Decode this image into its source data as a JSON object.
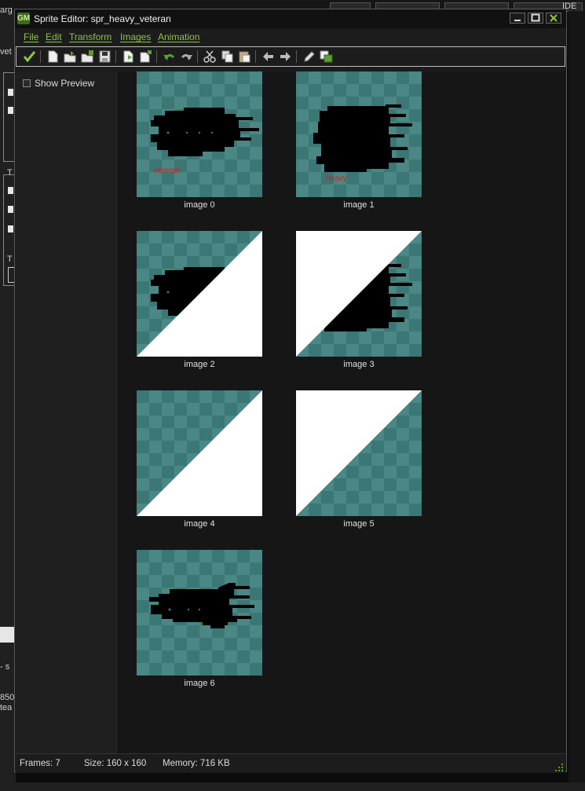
{
  "window": {
    "title": "Sprite Editor: spr_heavy_veteran",
    "logo": "GM",
    "minimize_icon": "minimize-icon",
    "maximize_icon": "maximize-icon",
    "close_icon": "close-icon"
  },
  "menu": {
    "items": [
      "File",
      "Edit",
      "Transform",
      "Images",
      "Animation"
    ]
  },
  "toolbar": {
    "icons": [
      "confirm-check-icon",
      "new-sprite-icon",
      "open-file-icon",
      "add-from-file-icon",
      "save-icon",
      "insert-image-icon",
      "add-image-icon",
      "undo-icon",
      "redo-icon",
      "cut-icon",
      "copy-icon",
      "paste-icon",
      "move-left-icon",
      "move-right-icon",
      "edit-pencil-icon",
      "colors-icon"
    ]
  },
  "left_panel": {
    "show_preview_label": "Show Preview",
    "show_preview_checked": false
  },
  "frames": [
    {
      "label": "image 0",
      "overlay_text": "veteran",
      "shape": "tank-small"
    },
    {
      "label": "image 1",
      "overlay_text": "heavy",
      "shape": "tank-heavy"
    },
    {
      "label": "image 2",
      "overlay_text": "",
      "shape": "tank-wipe-bottom-left"
    },
    {
      "label": "image 3",
      "overlay_text": "",
      "shape": "tank-wipe-top-left"
    },
    {
      "label": "image 4",
      "overlay_text": "",
      "shape": "wipe-bottom-left"
    },
    {
      "label": "image 5",
      "overlay_text": "",
      "shape": "wipe-top-left"
    },
    {
      "label": "image 6",
      "overlay_text": "",
      "shape": "tank-turret"
    }
  ],
  "status": {
    "frames": "Frames: 7",
    "size": "Size: 160 x 160",
    "memory": "Memory: 716 KB"
  },
  "background": {
    "frag_top_left": "arg",
    "frag_vet": "vet",
    "frag_t1": "T",
    "frag_t2": "T",
    "frag_s": "- s",
    "frag_850": "850",
    "frag_tea": "tea",
    "frag_ide": "IDE"
  },
  "colors": {
    "accent_green": "#8dc63f",
    "checker_dark": "#3a7775",
    "checker_light": "#4a8785",
    "sprite_text_red": "#e01818"
  }
}
